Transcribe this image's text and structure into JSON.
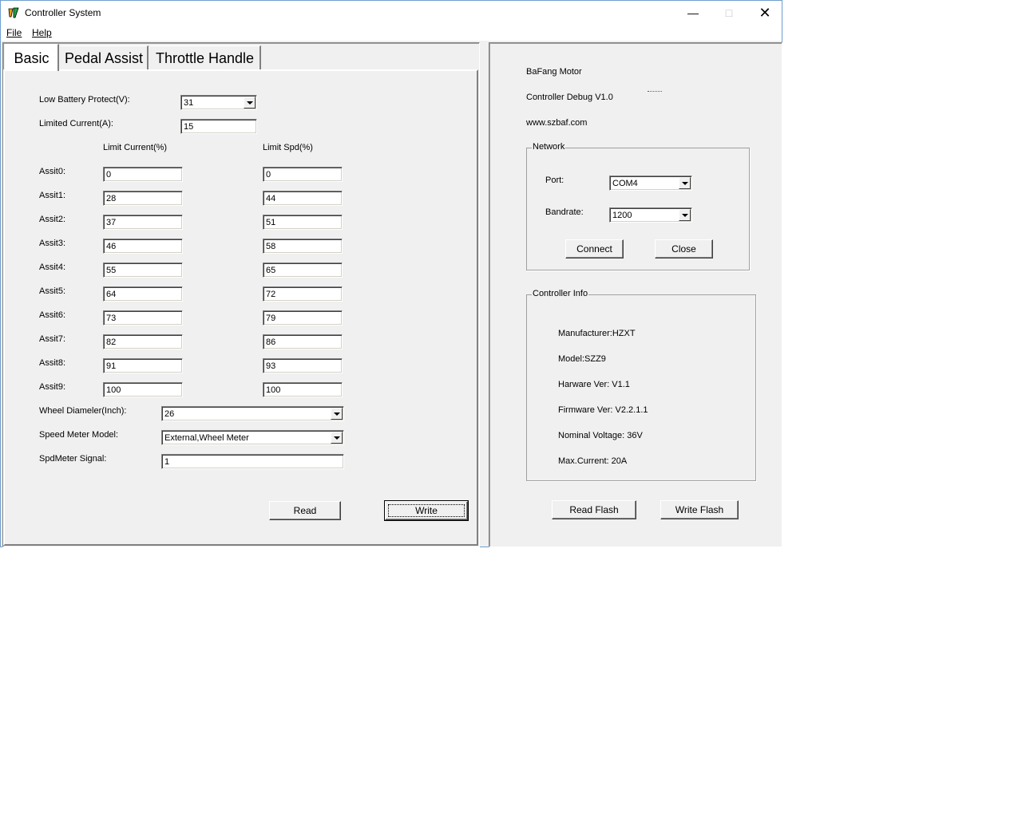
{
  "window": {
    "title": "Controller System"
  },
  "menu": {
    "file": "File",
    "help": "Help"
  },
  "tabs": [
    "Basic",
    "Pedal Assist",
    "Throttle Handle"
  ],
  "basic": {
    "low_battery_label": "Low Battery Protect(V):",
    "low_battery_value": "31",
    "limited_current_label": "Limited Current(A):",
    "limited_current_value": "15",
    "col_limit_current": "Limit Current(%)",
    "col_limit_spd": "Limit Spd(%)",
    "assists": [
      {
        "label": "Assit0:",
        "current": "0",
        "speed": "0"
      },
      {
        "label": "Assit1:",
        "current": "28",
        "speed": "44"
      },
      {
        "label": "Assit2:",
        "current": "37",
        "speed": "51"
      },
      {
        "label": "Assit3:",
        "current": "46",
        "speed": "58"
      },
      {
        "label": "Assit4:",
        "current": "55",
        "speed": "65"
      },
      {
        "label": "Assit5:",
        "current": "64",
        "speed": "72"
      },
      {
        "label": "Assit6:",
        "current": "73",
        "speed": "79"
      },
      {
        "label": "Assit7:",
        "current": "82",
        "speed": "86"
      },
      {
        "label": "Assit8:",
        "current": "91",
        "speed": "93"
      },
      {
        "label": "Assit9:",
        "current": "100",
        "speed": "100"
      }
    ],
    "wheel_label": "Wheel Diameler(Inch):",
    "wheel_value": "26",
    "speed_meter_label": "Speed Meter Model:",
    "speed_meter_value": "External,Wheel Meter",
    "spd_signal_label": "SpdMeter Signal:",
    "spd_signal_value": "1",
    "read_button": "Read",
    "write_button": "Write"
  },
  "info": {
    "line1": "BaFang Motor",
    "line2": "Controller Debug V1.0",
    "line3": "www.szbaf.com"
  },
  "network": {
    "legend": "Network",
    "port_label": "Port:",
    "port_value": "COM4",
    "baud_label": "Bandrate:",
    "baud_value": "1200",
    "connect_button": "Connect",
    "close_button": "Close"
  },
  "controller_info": {
    "legend": "Controller Info",
    "manufacturer": "Manufacturer:HZXT",
    "model": "Model:SZZ9",
    "hardware": "Harware Ver: V1.1",
    "firmware": "Firmware Ver: V2.2.1.1",
    "voltage": "Nominal Voltage: 36V",
    "current": "Max.Current: 20A"
  },
  "flash": {
    "read": "Read Flash",
    "write": "Write Flash"
  }
}
